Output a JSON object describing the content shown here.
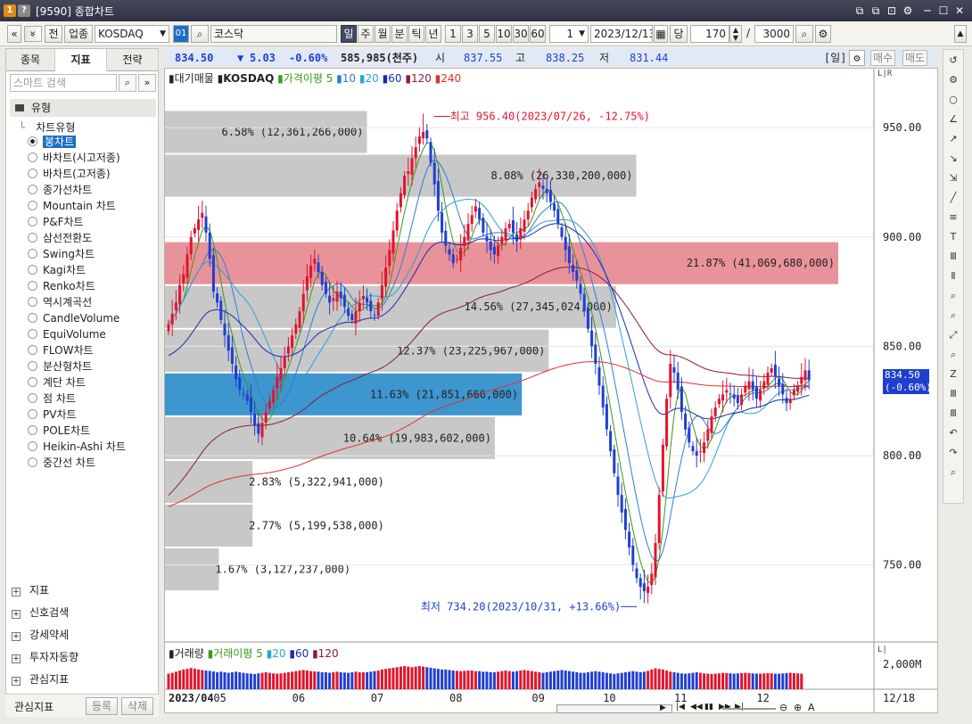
{
  "window": {
    "code_badge": "1",
    "help_badge": "?",
    "title": "[9590] 종합차트",
    "controls": [
      "⧉",
      "⧉",
      "⊡",
      "⚙",
      "─",
      "☐",
      "✕"
    ]
  },
  "toolbar": {
    "nav_prev": "«",
    "nav_menu": "»",
    "btn_prev": "전",
    "btn_sector": "업종",
    "market": "KOSDAQ",
    "code_badge": "01",
    "search_icon": "⌕",
    "index_name": "코스닥",
    "periods": [
      "일",
      "주",
      "월",
      "분",
      "틱",
      "년"
    ],
    "active_period": "일",
    "intervals": [
      "1",
      "3",
      "5",
      "10",
      "30",
      "60"
    ],
    "interval_value": "1",
    "date": "2023/12/13",
    "date_tag": "당",
    "count": "170",
    "slash": "/",
    "max": "3000"
  },
  "left_panel": {
    "tabs": [
      "종목",
      "지표",
      "전략"
    ],
    "active_tab": "지표",
    "search_placeholder": "스마트 검색",
    "category": "유형",
    "chart_type_label": "차트유형",
    "chart_types": [
      "봉차트",
      "바차트(시고저종)",
      "바차트(고저종)",
      "종가선차트",
      "Mountain 차트",
      "P&F차트",
      "삼선전환도",
      "Swing차트",
      "Kagi차트",
      "Renko차트",
      "역시계곡선",
      "CandleVolume",
      "EquiVolume",
      "FLOW차트",
      "분산형차트",
      "계단 차트",
      "점 차트",
      "PV차트",
      "POLE차트",
      "Heikin-Ashi 차트",
      "중간선 차트"
    ],
    "selected_type": "봉차트",
    "bottom_items": [
      "지표",
      "신호검색",
      "강세약세",
      "투자자동향",
      "관심지표"
    ],
    "fav_label": "관심지표",
    "register_btn": "등록",
    "delete_btn": "삭제"
  },
  "infobar": {
    "close": "834.50",
    "change_arrow": "▼",
    "change": "5.03",
    "pct": "-0.60%",
    "volume": "585,985(천주)",
    "open_label": "시",
    "open": "837.55",
    "high_label": "고",
    "high": "838.25",
    "low_label": "저",
    "low": "831.44",
    "period_tag": "[일]",
    "buy": "매수",
    "sell": "매도"
  },
  "colors": {
    "up": "#e0142c",
    "down": "#1f3fd0",
    "ma5": "#3a9a1a",
    "ma10": "#2a7fd0",
    "ma20": "#2aa0e0",
    "ma60": "#1a2ab0",
    "ma120": "#8a1a3a",
    "ma240": "#e03030",
    "vp_gray": "#c8c8c8",
    "vp_poc": "#e8939a",
    "vp_cur": "#3e96cf"
  },
  "chart_data": {
    "type": "candlestick",
    "legend": [
      "대기매물",
      "KOSDAQ",
      "가격이평 5",
      "10",
      "20",
      "60",
      "120",
      "240"
    ],
    "y_ticks": [
      950,
      900,
      850,
      800,
      750
    ],
    "y_tick_labels": [
      "950.00",
      "900.00",
      "850.00",
      "800.00",
      "750.00"
    ],
    "ylim": [
      716,
      968
    ],
    "x_labels": [
      {
        "label": "2023/04",
        "i": 0
      },
      {
        "label": "05",
        "i": 12
      },
      {
        "label": "06",
        "i": 33
      },
      {
        "label": "07",
        "i": 54
      },
      {
        "label": "08",
        "i": 75
      },
      {
        "label": "09",
        "i": 97
      },
      {
        "label": "10",
        "i": 116
      },
      {
        "label": "11",
        "i": 135
      },
      {
        "label": "12",
        "i": 157
      },
      {
        "label": "12/18",
        "i": 178
      }
    ],
    "high_annot": "최고 956.40(2023/07/26, -12.75%)",
    "low_annot": "최저 734.20(2023/10/31, +13.66%)",
    "current_label": "834.50",
    "current_pct": "(-0.60%)",
    "volume_title": [
      "거래량",
      "거래이평 5",
      "20",
      "60",
      "120"
    ],
    "vol_tick": "2,000M",
    "volume_profile": [
      {
        "lo": 938,
        "hi": 958,
        "pct": "6.58%",
        "vol": "(12,361,266,000)",
        "ratio": 0.3
      },
      {
        "lo": 918,
        "hi": 938,
        "pct": "8.08%",
        "vol": "(26,330,200,000)",
        "ratio": 0.7
      },
      {
        "lo": 878,
        "hi": 898,
        "pct": "21.87%",
        "vol": "(41,069,680,000)",
        "ratio": 1.0
      },
      {
        "lo": 858,
        "hi": 878,
        "pct": "14.56%",
        "vol": "(27,345,024,000)",
        "ratio": 0.67
      },
      {
        "lo": 838,
        "hi": 858,
        "pct": "12.37%",
        "vol": "(23,225,967,000)",
        "ratio": 0.57
      },
      {
        "lo": 818,
        "hi": 838,
        "pct": "11.63%",
        "vol": "(21,851,666,000)",
        "ratio": 0.53
      },
      {
        "lo": 798,
        "hi": 818,
        "pct": "10.64%",
        "vol": "(19,983,602,000)",
        "ratio": 0.49
      },
      {
        "lo": 778,
        "hi": 798,
        "pct": "2.83%",
        "vol": "(5,322,941,000)",
        "ratio": 0.13
      },
      {
        "lo": 758,
        "hi": 778,
        "pct": "2.77%",
        "vol": "(5,199,538,000)",
        "ratio": 0.13
      },
      {
        "lo": 738,
        "hi": 758,
        "pct": "1.67%",
        "vol": "(3,127,237,000)",
        "ratio": 0.08
      }
    ],
    "cur_band_index": 5,
    "poc_index": 2,
    "closes": [
      860,
      865,
      870,
      878,
      883,
      892,
      900,
      904,
      908,
      911,
      902,
      890,
      875,
      870,
      862,
      855,
      848,
      842,
      835,
      830,
      828,
      825,
      820,
      814,
      810,
      815,
      820,
      825,
      830,
      836,
      840,
      845,
      850,
      855,
      860,
      866,
      874,
      882,
      887,
      890,
      884,
      878,
      874,
      870,
      872,
      875,
      872,
      868,
      864,
      862,
      866,
      870,
      873,
      870,
      866,
      864,
      870,
      878,
      886,
      894,
      903,
      912,
      920,
      928,
      930,
      936,
      941,
      946,
      948,
      945,
      934,
      924,
      912,
      902,
      896,
      892,
      888,
      890,
      895,
      900,
      906,
      910,
      914,
      908,
      902,
      898,
      894,
      892,
      896,
      900,
      904,
      906,
      902,
      898,
      904,
      908,
      912,
      918,
      922,
      925,
      922,
      920,
      916,
      912,
      906,
      900,
      894,
      888,
      884,
      880,
      874,
      866,
      858,
      850,
      842,
      832,
      822,
      812,
      802,
      792,
      782,
      774,
      766,
      758,
      750,
      744,
      740,
      738,
      740,
      746,
      760,
      782,
      805,
      826,
      842,
      838,
      830,
      820,
      812,
      806,
      802,
      800,
      802,
      806,
      812,
      818,
      822,
      826,
      828,
      830,
      828,
      826,
      824,
      828,
      832,
      834,
      830,
      826,
      830,
      834,
      838,
      840,
      836,
      832,
      828,
      824,
      826,
      830,
      832,
      836,
      839,
      834.5
    ],
    "volumes": [
      0.55,
      0.58,
      0.62,
      0.66,
      0.7,
      0.72,
      0.75,
      0.73,
      0.7,
      0.68,
      0.66,
      0.65,
      0.63,
      0.6,
      0.62,
      0.6,
      0.58,
      0.6,
      0.62,
      0.6,
      0.58,
      0.56,
      0.55,
      0.54,
      0.56,
      0.58,
      0.6,
      0.58,
      0.56,
      0.55,
      0.56,
      0.58,
      0.6,
      0.62,
      0.64,
      0.66,
      0.68,
      0.66,
      0.64,
      0.63,
      0.62,
      0.6,
      0.6,
      0.58,
      0.6,
      0.62,
      0.6,
      0.59,
      0.58,
      0.6,
      0.62,
      0.6,
      0.6,
      0.6,
      0.62,
      0.64,
      0.66,
      0.7,
      0.72,
      0.74,
      0.76,
      0.78,
      0.8,
      0.82,
      0.8,
      0.78,
      0.8,
      0.82,
      0.8,
      0.78,
      0.76,
      0.74,
      0.72,
      0.7,
      0.7,
      0.68,
      0.66,
      0.65,
      0.64,
      0.65,
      0.66,
      0.66,
      0.64,
      0.64,
      0.62,
      0.62,
      0.6,
      0.6,
      0.62,
      0.64,
      0.66,
      0.64,
      0.62,
      0.64,
      0.66,
      0.68,
      0.66,
      0.64,
      0.62,
      0.6,
      0.58,
      0.6,
      0.62,
      0.64,
      0.66,
      0.68,
      0.66,
      0.64,
      0.62,
      0.6,
      0.58,
      0.58,
      0.6,
      0.62,
      0.64,
      0.62,
      0.6,
      0.58,
      0.56,
      0.54,
      0.56,
      0.58,
      0.6,
      0.62,
      0.64,
      0.62,
      0.6,
      0.62,
      0.65,
      0.7,
      0.74,
      0.72,
      0.7,
      0.66,
      0.62,
      0.6,
      0.58,
      0.56,
      0.55,
      0.56,
      0.58,
      0.6,
      0.58,
      0.56,
      0.55,
      0.54,
      0.55,
      0.56,
      0.58,
      0.57,
      0.56,
      0.55,
      0.56,
      0.57,
      0.58,
      0.57,
      0.56,
      0.55,
      0.55,
      0.56,
      0.57,
      0.56,
      0.55,
      0.55,
      0.56,
      0.57,
      0.58,
      0.57,
      0.56,
      0.55
    ]
  },
  "right_tools": [
    "↺",
    "⚙",
    "○",
    "∠",
    "↗",
    "↘",
    "⇲",
    "╱",
    "≡",
    "T",
    "Ⅲ",
    "Ⅱ",
    "⌕",
    "⌕",
    "⤢",
    "⌕",
    "Z",
    "Ⅲ",
    "Ⅲ",
    "↶",
    "↷",
    "⌕"
  ],
  "statusbar": {
    "nav": [
      "|◀",
      "◀◀",
      "▮▮",
      "▶▶",
      "▶|"
    ],
    "zoom_out": "⊖",
    "zoom_in": "⊕",
    "text_tool": "A"
  }
}
